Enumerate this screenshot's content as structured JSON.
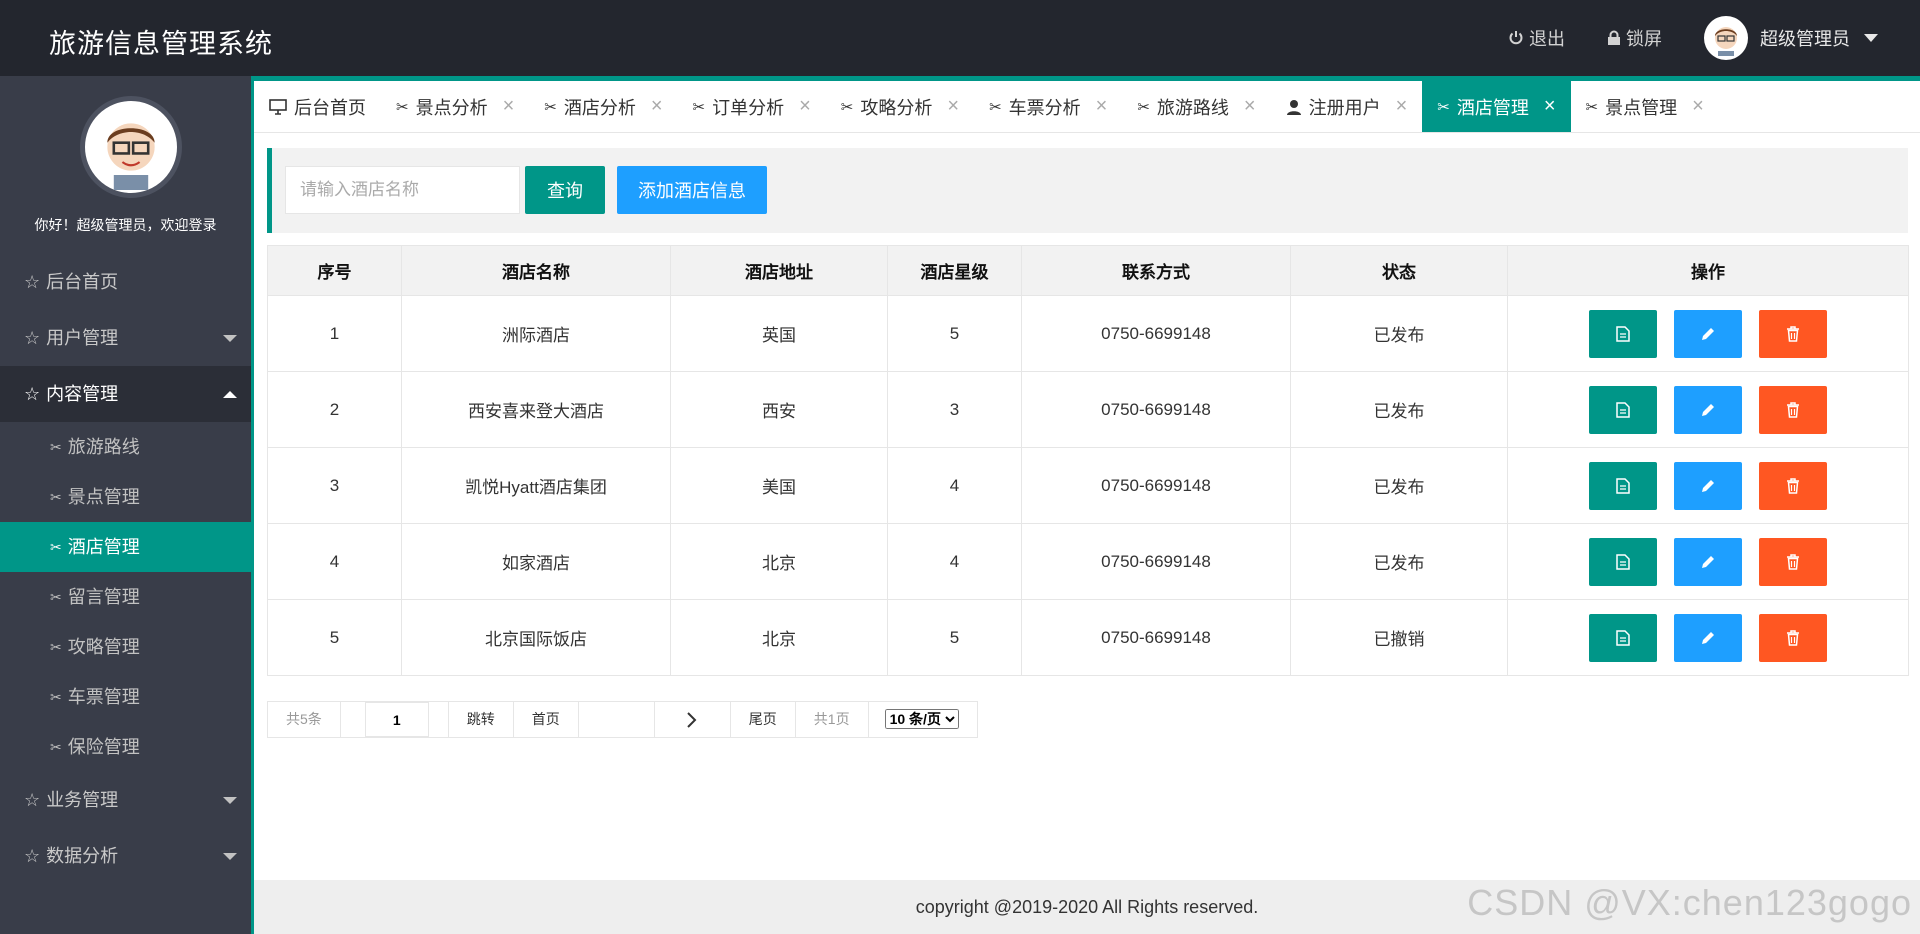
{
  "app_title": "旅游信息管理系统",
  "header": {
    "logout": "退出",
    "lock": "锁屏",
    "user": "超级管理员"
  },
  "sidebar": {
    "welcome": "你好！超级管理员，欢迎登录",
    "menu": {
      "home": "后台首页",
      "users": "用户管理",
      "content": "内容管理",
      "business": "业务管理",
      "analysis": "数据分析"
    },
    "sub": [
      "旅游路线",
      "景点管理",
      "酒店管理",
      "留言管理",
      "攻略管理",
      "车票管理",
      "保险管理"
    ]
  },
  "tabs": [
    "后台首页",
    "景点分析",
    "酒店分析",
    "订单分析",
    "攻略分析",
    "车票分析",
    "旅游路线",
    "注册用户",
    "酒店管理",
    "景点管理"
  ],
  "toolbar": {
    "search_placeholder": "请输入酒店名称",
    "query_label": "查询",
    "add_label": "添加酒店信息"
  },
  "table": {
    "headers": [
      "序号",
      "酒店名称",
      "酒店地址",
      "酒店星级",
      "联系方式",
      "状态",
      "操作"
    ],
    "rows": [
      [
        "1",
        "洲际酒店",
        "英国",
        "5",
        "0750-6699148",
        "已发布"
      ],
      [
        "2",
        "西安喜来登大酒店",
        "西安",
        "3",
        "0750-6699148",
        "已发布"
      ],
      [
        "3",
        "凯悦Hyatt酒店集团",
        "美国",
        "4",
        "0750-6699148",
        "已发布"
      ],
      [
        "4",
        "如家酒店",
        "北京",
        "4",
        "0750-6699148",
        "已发布"
      ],
      [
        "5",
        "北京国际饭店",
        "北京",
        "5",
        "0750-6699148",
        "已撤销"
      ]
    ]
  },
  "pager": {
    "total": "共5条",
    "page_value": "1",
    "jump": "跳转",
    "first": "首页",
    "last": "尾页",
    "pages": "共1页",
    "per_page": "10 条/页"
  },
  "footer": "copyright @2019-2020 All Rights reserved.",
  "watermark": "CSDN @VX:chen123gogo",
  "colors": {
    "primary": "#009688",
    "blue": "#1e9fff",
    "orange": "#ff5722",
    "dark": "#23262e",
    "sidebar": "#393d49"
  }
}
